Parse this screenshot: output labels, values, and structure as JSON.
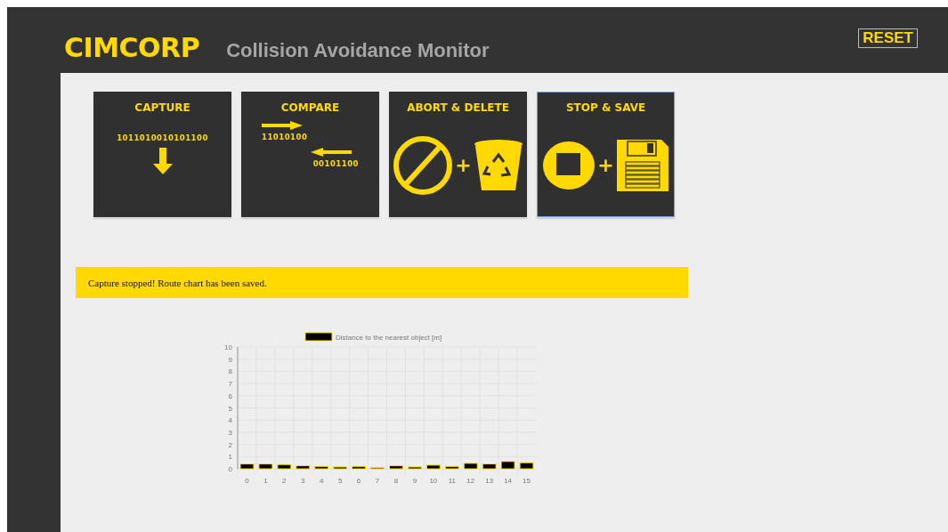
{
  "header": {
    "logo": "CIMCORP",
    "title": "Collision Avoidance Monitor",
    "reset_button": "RESET"
  },
  "tiles": [
    {
      "kind": "capture",
      "label": "CAPTURE",
      "selected": false,
      "codes": [
        "1011010010101100"
      ]
    },
    {
      "kind": "compare",
      "label": "COMPARE",
      "selected": false,
      "codes": [
        "11010100",
        "00101100"
      ]
    },
    {
      "kind": "abort",
      "label": "ABORT & DELETE",
      "selected": false,
      "plus": "+"
    },
    {
      "kind": "stop",
      "label": "STOP & SAVE",
      "selected": true,
      "plus": "+"
    }
  ],
  "message": "Capture stopped! Route chart has been saved.",
  "chart_data": {
    "type": "bar",
    "categories": [
      "0",
      "1",
      "2",
      "3",
      "4",
      "5",
      "6",
      "7",
      "8",
      "9",
      "10",
      "11",
      "12",
      "13",
      "14",
      "15"
    ],
    "series": [
      {
        "name": "Distance to the nearest object [m]",
        "color": "#000000",
        "values": [
          0.4,
          0.4,
          0.35,
          0.25,
          0.2,
          0.15,
          0.2,
          0.1,
          0.25,
          0.15,
          0.3,
          0.2,
          0.45,
          0.4,
          0.6,
          0.5
        ]
      }
    ],
    "ylim": [
      0,
      10
    ],
    "grid": true,
    "yticks": [
      0,
      1,
      2,
      3,
      4,
      5,
      6,
      7,
      8,
      9,
      10
    ]
  }
}
